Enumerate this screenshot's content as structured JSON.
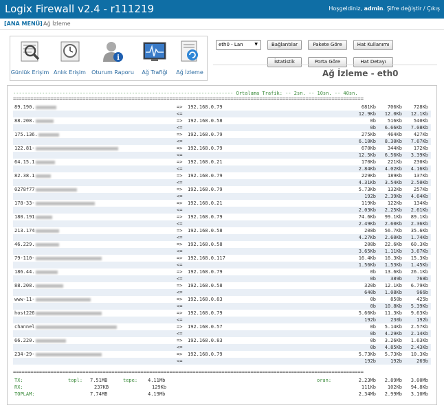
{
  "header": {
    "app_title": "Logix Firewall v2.4 - r111219",
    "welcome": "Hoşgeldiniz,",
    "username": "admin",
    "links": ". Şifre değiştir / Çıkış"
  },
  "breadcrumb": {
    "home": "[ANA MENÜ]",
    "sep": "›",
    "current": "Ağ İzleme"
  },
  "nav_icons": [
    {
      "label": "Günlük Erişim",
      "icon": "daily-log-icon"
    },
    {
      "label": "Anlık Erişim",
      "icon": "realtime-access-icon"
    },
    {
      "label": "Oturum Raporu",
      "icon": "session-report-icon"
    },
    {
      "label": "Ağ Trafiği",
      "icon": "network-traffic-icon"
    },
    {
      "label": "Ağ İzleme",
      "icon": "network-monitor-icon"
    }
  ],
  "controls": {
    "interface": "eth0 - Lan",
    "buttons": {
      "connections": "Bağlantılar",
      "by_packet": "Pakete Göre",
      "line_usage": "Hat Kullanımı",
      "statistics": "İstatistik",
      "by_port": "Porta Göre",
      "line_detail": "Hat Detayı"
    }
  },
  "page_title": "Ağ İzleme - eth0",
  "traffic": {
    "header_line": "---------------------------------------------------------------------------- Ortalama Trafik: -- 2sn. -- 10sn. -- 40sn.",
    "separator": "=========================================================================================================================",
    "flows": [
      {
        "host": "89.190.",
        "dest": "192.168.0.79",
        "out": [
          "681Kb",
          "706Kb",
          "728Kb"
        ],
        "in": [
          "12.9Kb",
          "12.0Kb",
          "12.1Kb"
        ]
      },
      {
        "host": "88.208.",
        "dest": "192.168.0.58",
        "out": [
          "0b",
          "516Kb",
          "540Kb"
        ],
        "in": [
          "0b",
          "6.66Kb",
          "7.08Kb"
        ]
      },
      {
        "host": "175.136.",
        "dest": "192.168.0.79",
        "out": [
          "275Kb",
          "464Kb",
          "427Kb"
        ],
        "in": [
          "6.10Kb",
          "8.30Kb",
          "7.67Kb"
        ]
      },
      {
        "host": "122.81-",
        "dest": "192.168.0.79",
        "out": [
          "670Kb",
          "344Kb",
          "172Kb"
        ],
        "in": [
          "12.5Kb",
          "6.56Kb",
          "3.39Kb"
        ]
      },
      {
        "host": "64.15.1",
        "dest": "192.168.0.21",
        "out": [
          "170Kb",
          "221Kb",
          "230Kb"
        ],
        "in": [
          "2.84Kb",
          "4.02Kb",
          "4.16Kb"
        ]
      },
      {
        "host": "82.38.1",
        "dest": "192.168.0.79",
        "out": [
          "229Kb",
          "189Kb",
          "137Kb"
        ],
        "in": [
          "4.31Kb",
          "3.54Kb",
          "2.50Kb"
        ]
      },
      {
        "host": "0278f77",
        "dest": "192.168.0.79",
        "out": [
          "5.73Kb",
          "132Kb",
          "257Kb"
        ],
        "in": [
          "192b",
          "2.39Kb",
          "4.64Kb"
        ]
      },
      {
        "host": "178-33-",
        "dest": "192.168.0.21",
        "out": [
          "119Kb",
          "122Kb",
          "134Kb"
        ],
        "in": [
          "2.03Kb",
          "2.25Kb",
          "2.61Kb"
        ]
      },
      {
        "host": "180.191",
        "dest": "192.168.0.79",
        "out": [
          "74.6Kb",
          "99.1Kb",
          "89.1Kb"
        ],
        "in": [
          "2.49Kb",
          "2.60Kb",
          "2.36Kb"
        ]
      },
      {
        "host": "213.174",
        "dest": "192.168.0.58",
        "out": [
          "208b",
          "56.7Kb",
          "35.6Kb"
        ],
        "in": [
          "4.27Kb",
          "2.60Kb",
          "1.74Kb"
        ]
      },
      {
        "host": "46.229.",
        "dest": "192.168.0.58",
        "out": [
          "208b",
          "22.6Kb",
          "60.3Kb"
        ],
        "in": [
          "3.65Kb",
          "1.11Kb",
          "3.67Kb"
        ]
      },
      {
        "host": "79-110-",
        "dest": "192.168.0.117",
        "out": [
          "16.4Kb",
          "16.3Kb",
          "15.3Kb"
        ],
        "in": [
          "1.56Kb",
          "1.53Kb",
          "1.45Kb"
        ]
      },
      {
        "host": "186.44.",
        "dest": "192.168.0.79",
        "out": [
          "0b",
          "13.6Kb",
          "26.1Kb"
        ],
        "in": [
          "0b",
          "389b",
          "768b"
        ]
      },
      {
        "host": "88.208.",
        "dest": "192.168.0.58",
        "out": [
          "320b",
          "12.1Kb",
          "6.79Kb"
        ],
        "in": [
          "640b",
          "1.08Kb",
          "966b"
        ]
      },
      {
        "host": "www-11-",
        "dest": "192.168.0.83",
        "out": [
          "0b",
          "850b",
          "425b"
        ],
        "in": [
          "0b",
          "10.8Kb",
          "5.39Kb"
        ]
      },
      {
        "host": "host226",
        "dest": "192.168.0.79",
        "out": [
          "5.66Kb",
          "11.3Kb",
          "9.63Kb"
        ],
        "in": [
          "192b",
          "230b",
          "192b"
        ]
      },
      {
        "host": "channel",
        "dest": "192.168.0.57",
        "out": [
          "0b",
          "5.14Kb",
          "2.57Kb"
        ],
        "in": [
          "0b",
          "4.29Kb",
          "2.14Kb"
        ]
      },
      {
        "host": "66.220.",
        "dest": "192.168.0.83",
        "out": [
          "0b",
          "3.26Kb",
          "1.63Kb"
        ],
        "in": [
          "0b",
          "4.85Kb",
          "2.43Kb"
        ]
      },
      {
        "host": "234-29-",
        "dest": "192.168.0.79",
        "out": [
          "5.73Kb",
          "5.73Kb",
          "10.3Kb"
        ],
        "in": [
          "192b",
          "192b",
          "269b"
        ]
      }
    ],
    "arrow_out": "=>",
    "arrow_in": "<=",
    "summary": {
      "tx": {
        "label": "TX:",
        "topl_label": "topl:",
        "topl": "7.51MB",
        "tepe_label": "tepe:",
        "tepe": "4.11Mb",
        "oran_label": "oran:",
        "rates": [
          "2.23Mb",
          "2.89Mb",
          "3.00Mb"
        ]
      },
      "rx": {
        "label": "RX:",
        "topl": "237KB",
        "tepe": "129Kb",
        "rates": [
          "111Kb",
          "102Kb",
          "94.8Kb"
        ]
      },
      "total": {
        "label": "TOPLAM:",
        "topl": "7.74MB",
        "tepe": "4.19Mb",
        "rates": [
          "2.34Mb",
          "2.99Mb",
          "3.10Mb"
        ]
      }
    }
  }
}
